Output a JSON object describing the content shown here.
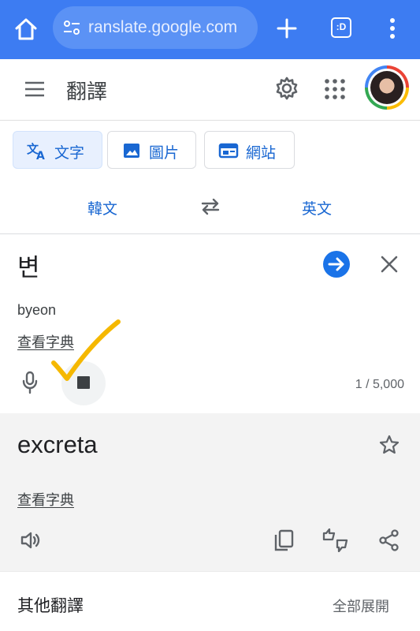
{
  "browser": {
    "url": "ranslate.google.com",
    "tabs_label": ":D"
  },
  "app": {
    "title": "翻譯"
  },
  "modes": [
    {
      "label": "文字"
    },
    {
      "label": "圖片"
    },
    {
      "label": "網站"
    }
  ],
  "languages": {
    "source": "韓文",
    "target": "英文"
  },
  "source": {
    "text": "변",
    "romanization": "byeon",
    "dictionary_link": "查看字典",
    "char_count": "1 / 5,000"
  },
  "result": {
    "text": "excreta",
    "dictionary_link": "查看字典"
  },
  "other_translations": {
    "title": "其他翻譯",
    "expand_all": "全部展開"
  },
  "colors": {
    "browser_bar": "#3d7cf2",
    "accent": "#1a73e8",
    "annotation_check": "#f5b800"
  }
}
